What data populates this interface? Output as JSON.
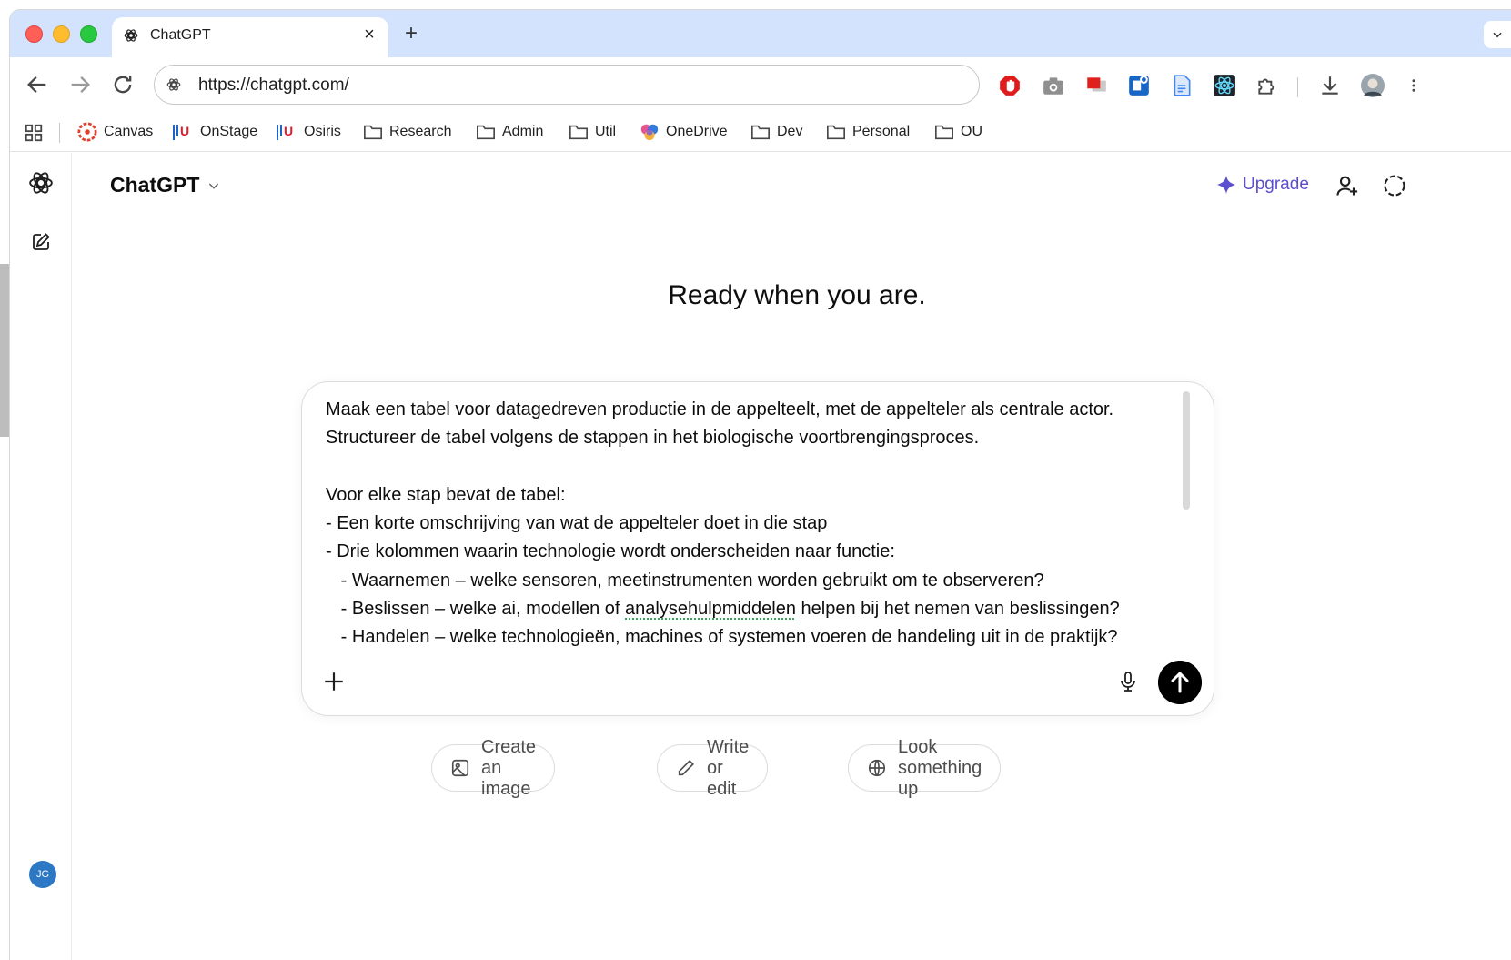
{
  "browser": {
    "tab": {
      "title": "ChatGPT",
      "close": "×"
    },
    "new_tab": "+",
    "tab_menu": "⌄",
    "url": "https://chatgpt.com/",
    "bookmarks": [
      {
        "label": "Canvas",
        "icon": "canvas-logo-icon"
      },
      {
        "label": "OnStage",
        "icon": "uu-logo-icon"
      },
      {
        "label": "Osiris",
        "icon": "uu-logo-icon"
      },
      {
        "label": "Research",
        "icon": "folder-icon"
      },
      {
        "label": "Admin",
        "icon": "folder-icon"
      },
      {
        "label": "Util",
        "icon": "folder-icon"
      },
      {
        "label": "OneDrive",
        "icon": "onedrive-logo-icon"
      },
      {
        "label": "Dev",
        "icon": "folder-icon"
      },
      {
        "label": "Personal",
        "icon": "folder-icon"
      },
      {
        "label": "OU",
        "icon": "folder-icon"
      }
    ]
  },
  "app": {
    "title": "ChatGPT",
    "upgrade_label": "Upgrade",
    "avatar_initials": "JG",
    "hero": "Ready when you are.",
    "composer": {
      "lines": [
        "Maak een tabel voor datagedreven productie in de appelteelt, met de appelteler als centrale actor.",
        "Structureer de tabel volgens de stappen in het biologische voortbrengingsproces.",
        "",
        "Voor elke stap bevat de tabel:",
        "- Een korte omschrijving van wat de appelteler doet in die stap",
        "- Drie kolommen waarin technologie wordt onderscheiden naar functie:",
        "   - Waarnemen – welke sensoren, meetinstrumenten worden gebruikt om te observeren?",
        "   - Beslissen – welke ai, modellen of ",
        "analysehulpmiddelen",
        " helpen bij het nemen van beslissingen?",
        "   - Handelen – welke technologieën, machines of systemen voeren de handeling uit in de praktijk?"
      ]
    },
    "chips": [
      {
        "label": "Create an image",
        "icon": "image-icon"
      },
      {
        "label": "Write or edit",
        "icon": "pencil-icon"
      },
      {
        "label": "Look something up",
        "icon": "globe-icon"
      }
    ]
  },
  "colors": {
    "tabstrip": "#d3e3fd",
    "upgrade": "#5b4ecf",
    "avatar": "#2d78c4",
    "send": "#000000"
  }
}
